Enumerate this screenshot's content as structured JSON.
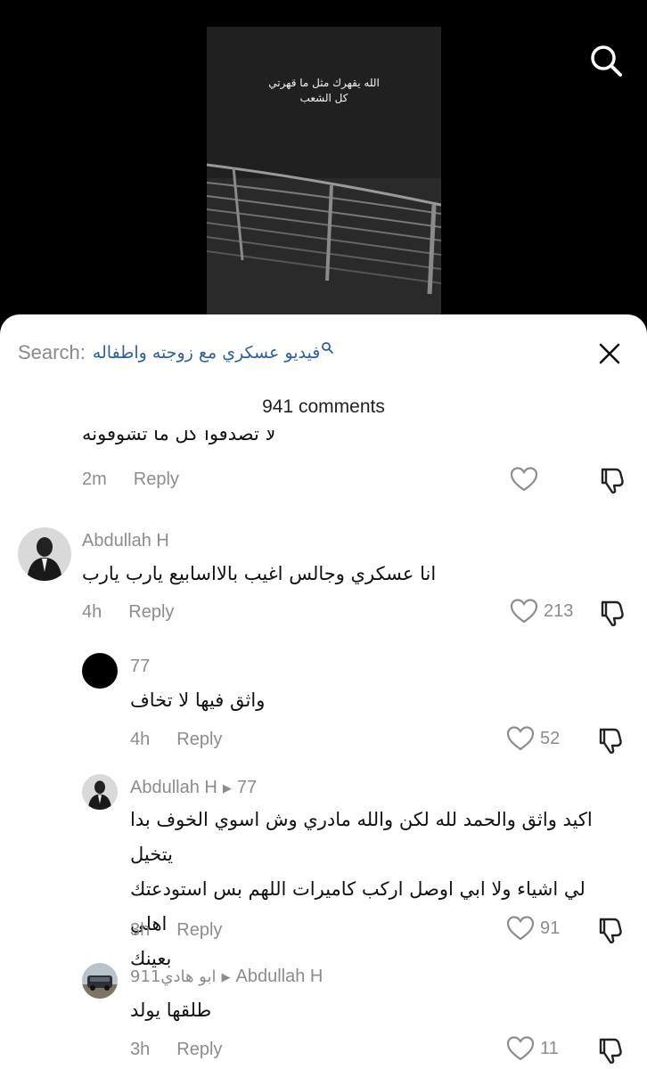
{
  "video": {
    "caption_line1": "الله يقهرك مثل ما قهرتي",
    "caption_line2": "كل الشعب"
  },
  "search": {
    "prefix": "Search:",
    "query": "فيديو عسكري مع زوجته واطفاله"
  },
  "comments_header": {
    "count_label": "941 comments"
  },
  "comments": [
    {
      "text": "لا تصدقوا كل ما تشوفونه",
      "time": "2m",
      "reply_label": "Reply",
      "likes": ""
    },
    {
      "name": "Abdullah H",
      "text": "انا عسكري وجالس اغيب بالااسابيع يارب يارب",
      "time": "4h",
      "reply_label": "Reply",
      "likes": "213"
    },
    {
      "name": "77",
      "text": "واثق فيها لا تخاف",
      "time": "4h",
      "reply_label": "Reply",
      "likes": "52"
    },
    {
      "name": "Abdullah H",
      "reply_to": "77",
      "text_lines": [
        "اكيد واثق والحمد لله لكن والله مادري وش اسوي الخوف بدا يتخيل",
        "لي اشياء ولا ابي اوصل اركب كاميرات اللهم بس استودعتك اهلي",
        "بعينك"
      ],
      "time": "3h",
      "reply_label": "Reply",
      "likes": "91"
    },
    {
      "name": "ابو هادي911",
      "reply_to": "Abdullah H",
      "text": "طلقها يولد",
      "time": "3h",
      "reply_label": "Reply",
      "likes": "11"
    }
  ],
  "icons": {
    "search": "search-icon",
    "close": "close-icon",
    "like": "heart-icon",
    "dislike": "thumbs-down-icon"
  },
  "colors": {
    "search_query": "#2f5f9e",
    "muted_text": "#8c8c8c",
    "background_top": "#000000"
  }
}
